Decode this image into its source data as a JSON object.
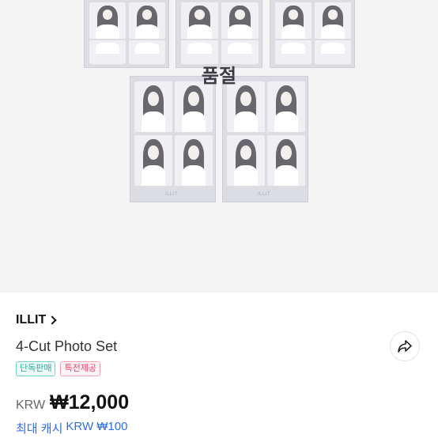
{
  "image": {
    "sold_out_label": "품절",
    "card_caption": "ILLIT"
  },
  "product": {
    "brand": "ILLIT",
    "title": "4-Cut Photo Set",
    "badges": [
      {
        "label": "단독판매",
        "color": "#1bb0a4"
      },
      {
        "label": "특전제공",
        "color": "#e8466e"
      }
    ],
    "currency": "KRW",
    "price": "₩12,000",
    "cash_label": "최대 캐시",
    "cash_value": "KRW ₩100"
  },
  "icons": {
    "share": "share-arrow-icon",
    "brand_chevron": "chevron-right-icon"
  },
  "colors": {
    "accent_blue": "#2f6fe4",
    "teal": "#1bb0a4",
    "pink": "#e8466e"
  }
}
